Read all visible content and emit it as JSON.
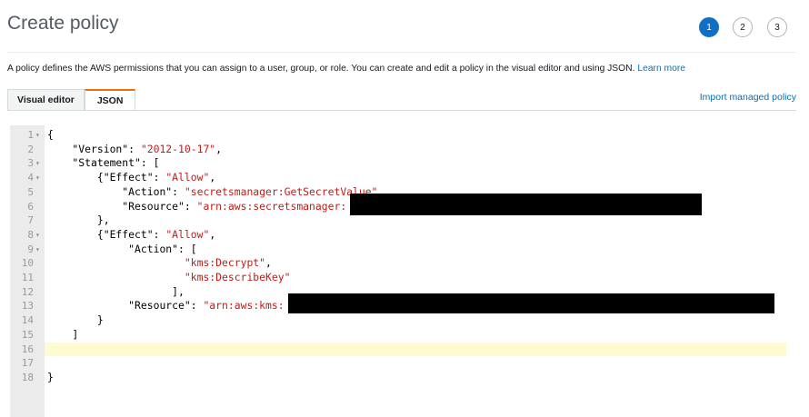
{
  "page": {
    "title": "Create policy",
    "steps": [
      "1",
      "2",
      "3"
    ],
    "active_step": "1",
    "description": "A policy defines the AWS permissions that you can assign to a user, group, or role. You can create and edit a policy in the visual editor and using JSON.",
    "learn_more": "Learn more"
  },
  "tabs": [
    {
      "label": "Visual editor",
      "active": false
    },
    {
      "label": "JSON",
      "active": true
    }
  ],
  "import_link": "Import managed policy",
  "editor": {
    "active_line": 16,
    "lines": [
      {
        "n": "1",
        "fold": true,
        "segs": [
          {
            "t": "{"
          }
        ]
      },
      {
        "n": "2",
        "fold": false,
        "segs": [
          {
            "t": "    \"Version\": "
          },
          {
            "t": "\"2012-10-17\"",
            "s": 1
          },
          {
            "t": ","
          }
        ]
      },
      {
        "n": "3",
        "fold": true,
        "segs": [
          {
            "t": "    \"Statement\": ["
          }
        ]
      },
      {
        "n": "4",
        "fold": true,
        "segs": [
          {
            "t": "        {\"Effect\": "
          },
          {
            "t": "\"Allow\"",
            "s": 1
          },
          {
            "t": ","
          }
        ]
      },
      {
        "n": "5",
        "fold": false,
        "segs": [
          {
            "t": "            \"Action\": "
          },
          {
            "t": "\"secretsmanager:GetSecretValue\"",
            "s": 1
          },
          {
            "t": ","
          }
        ]
      },
      {
        "n": "6",
        "fold": false,
        "segs": [
          {
            "t": "            \"Resource\": "
          },
          {
            "t": "\"arn:aws:secretsmanager:",
            "s": 1
          }
        ]
      },
      {
        "n": "7",
        "fold": false,
        "segs": [
          {
            "t": "        },"
          }
        ]
      },
      {
        "n": "8",
        "fold": true,
        "segs": [
          {
            "t": "        {\"Effect\": "
          },
          {
            "t": "\"Allow\"",
            "s": 1
          },
          {
            "t": ","
          }
        ]
      },
      {
        "n": "9",
        "fold": true,
        "segs": [
          {
            "t": "             \"Action\": ["
          }
        ]
      },
      {
        "n": "10",
        "fold": false,
        "segs": [
          {
            "t": "                      "
          },
          {
            "t": "\"kms:Decrypt\"",
            "s": 1
          },
          {
            "t": ","
          }
        ]
      },
      {
        "n": "11",
        "fold": false,
        "segs": [
          {
            "t": "                      "
          },
          {
            "t": "\"kms:DescribeKey\"",
            "s": 1
          }
        ]
      },
      {
        "n": "12",
        "fold": false,
        "segs": [
          {
            "t": "                    ],"
          }
        ]
      },
      {
        "n": "13",
        "fold": false,
        "segs": [
          {
            "t": "             \"Resource\": "
          },
          {
            "t": "\"arn:aws:kms:",
            "s": 1
          }
        ]
      },
      {
        "n": "14",
        "fold": false,
        "segs": [
          {
            "t": "        }"
          }
        ]
      },
      {
        "n": "15",
        "fold": false,
        "segs": [
          {
            "t": "    ]"
          }
        ]
      },
      {
        "n": "16",
        "fold": false,
        "segs": []
      },
      {
        "n": "17",
        "fold": false,
        "segs": []
      },
      {
        "n": "18",
        "fold": false,
        "segs": [
          {
            "t": "}"
          }
        ]
      }
    ]
  },
  "colors": {
    "accent": "#0f6fc5",
    "tab_accent": "#ec7211",
    "string": "#c41a16",
    "link": "#0073bb"
  }
}
